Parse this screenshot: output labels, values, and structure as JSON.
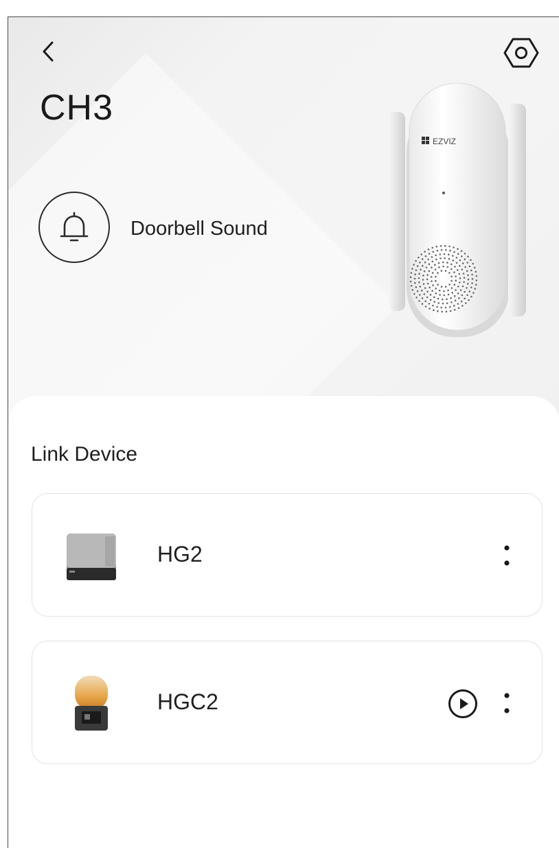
{
  "header": {
    "title": "CH3",
    "back_icon": "chevron-left-icon",
    "settings_icon": "hexagon-settings-icon"
  },
  "doorbell": {
    "icon": "bell-icon",
    "label": "Doorbell Sound"
  },
  "hero_device": {
    "brand": "EZVIZ"
  },
  "link_section": {
    "title": "Link Device",
    "devices": [
      {
        "name": "HG2",
        "thumbnail": "gateway-device-image",
        "actions": [
          "more-vertical-icon"
        ]
      },
      {
        "name": "HGC2",
        "thumbnail": "lamp-device-image",
        "actions": [
          "play-circle-icon",
          "more-vertical-icon"
        ]
      }
    ]
  },
  "colors": {
    "hero_background": "#f2f2f2",
    "panel_background": "#ffffff",
    "text": "#1f1f1f",
    "card_border": "#e3e3e3"
  }
}
